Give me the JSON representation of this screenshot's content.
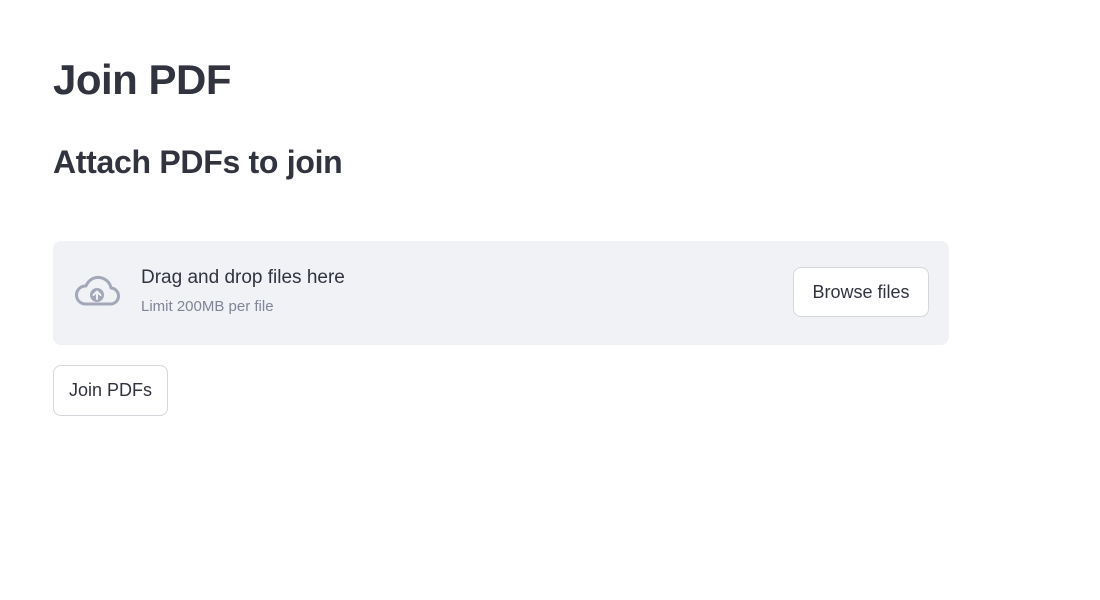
{
  "page": {
    "title": "Join PDF",
    "subtitle": "Attach PDFs to join"
  },
  "uploader": {
    "icon": "cloud-upload-icon",
    "primary_text": "Drag and drop files here",
    "secondary_text": "Limit 200MB per file",
    "browse_label": "Browse files",
    "background_color": "#f0f2f6"
  },
  "actions": {
    "join_label": "Join PDFs"
  }
}
